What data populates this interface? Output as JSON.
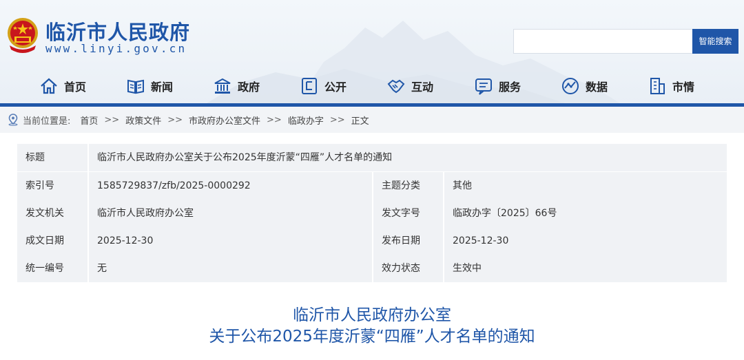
{
  "header": {
    "site_title": "临沂市人民政府",
    "site_url": "www.linyi.gov.cn",
    "search": {
      "placeholder": "",
      "button_label": "智能搜索"
    },
    "brand_color": "#1f56a8",
    "emblem_icon": "national-emblem-icon"
  },
  "nav": {
    "items": [
      {
        "label": "首页",
        "icon": "home-icon"
      },
      {
        "label": "新闻",
        "icon": "news-book-icon"
      },
      {
        "label": "政府",
        "icon": "government-building-icon"
      },
      {
        "label": "公开",
        "icon": "document-icon"
      },
      {
        "label": "互动",
        "icon": "handshake-icon"
      },
      {
        "label": "服务",
        "icon": "service-chat-icon"
      },
      {
        "label": "数据",
        "icon": "data-globe-icon"
      },
      {
        "label": "市情",
        "icon": "city-building-icon"
      }
    ]
  },
  "breadcrumb": {
    "lead": "当前位置是:",
    "separator": ">>",
    "items": [
      "首页",
      "政策文件",
      "市政府办公室文件",
      "临政办字",
      "正文"
    ]
  },
  "meta": {
    "title_label": "标题",
    "title_value": "临沂市人民政府办公室关于公布2025年度沂蒙“四雁”人才名单的通知",
    "rows": [
      {
        "label": "索引号",
        "value": "1585729837/zfb/2025-0000292",
        "label2": "主题分类",
        "value2": "其他"
      },
      {
        "label": "发文机关",
        "value": "临沂市人民政府办公室",
        "label2": "发文字号",
        "value2": "临政办字〔2025〕66号"
      },
      {
        "label": "成文日期",
        "value": "2025-12-30",
        "label2": "发布日期",
        "value2": "2025-12-30"
      },
      {
        "label": "统一编号",
        "value": "无",
        "label2": "效力状态",
        "value2": "生效中"
      }
    ]
  },
  "document": {
    "title_line1": "临沂市人民政府办公室",
    "title_line2": "关于公布2025年度沂蒙“四雁”人才名单的通知"
  }
}
